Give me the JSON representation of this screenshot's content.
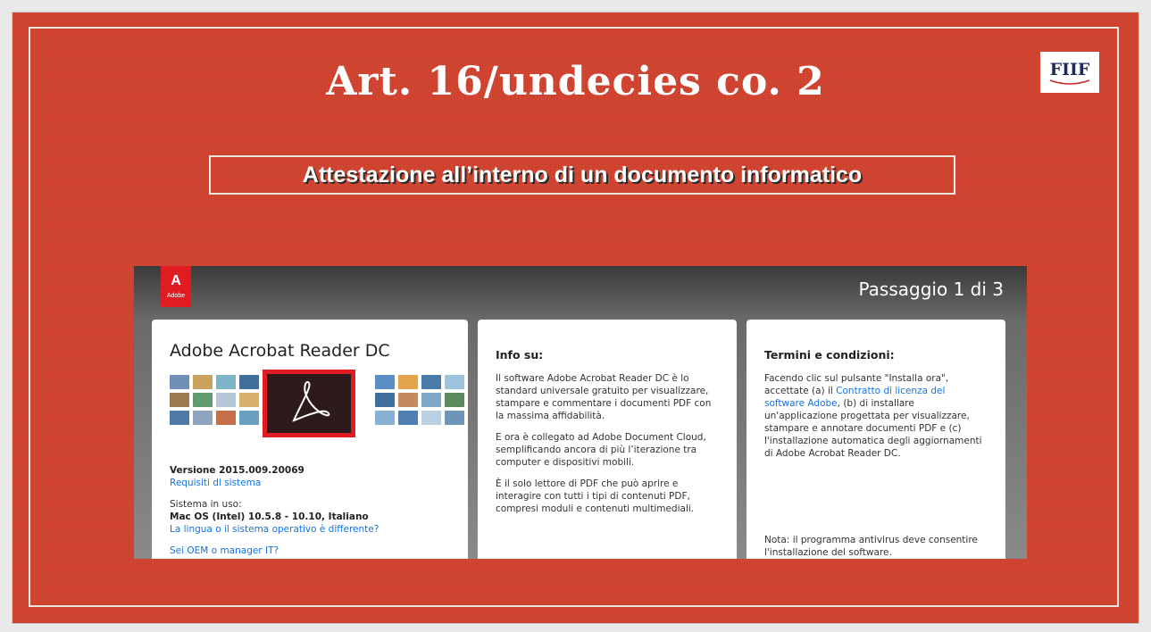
{
  "slide": {
    "title": "Art. 16/undecies co. 2",
    "logo_text": "FIIF",
    "subtitle": "Attestazione all’interno di un documento informatico"
  },
  "installer": {
    "brand_badge": "Adobe",
    "step": "Passaggio 1 di 3",
    "product": {
      "name": "Adobe Acrobat Reader DC",
      "version": "Versione 2015.009.20069",
      "requirements_link": "Requisiti di sistema",
      "system_label": "Sistema in uso:",
      "system_value": "Mac OS (Intel) 10.5.8 - 10.10, Italiano",
      "different_link": "La lingua o il sistema operativo è differente?",
      "oem_link": "Sei OEM o manager IT?"
    },
    "info": {
      "heading": "Info su:",
      "paragraphs": [
        "Il software Adobe Acrobat Reader DC è lo standard universale gratuito per visualizzare, stampare e commentare i documenti PDF con la massima affidabilità.",
        "E ora è collegato ad Adobe Document Cloud, semplificando ancora di più l’iterazione tra computer e dispositivi mobili.",
        "È il solo lettore di PDF che può aprire e interagire con tutti i tipi di contenuti PDF, compresi moduli e contenuti multimediali."
      ]
    },
    "terms": {
      "heading": "Termini e condizioni:",
      "text_before": "Facendo clic sul pulsante \"Installa ora\", accettate (a) il ",
      "license_link": "Contratto di licenza del software Adobe",
      "text_after": ", (b) di installare un'applicazione progettata per visualizzare, stampare e annotare documenti PDF e (c) l'installazione automatica degli aggiornamenti di Adobe Acrobat Reader DC.",
      "note": "Nota: il programma antivirus deve consentire l'installazione del software."
    }
  },
  "colors": {
    "slide_red": "#d2432f",
    "adobe_red": "#e11b22",
    "link_blue": "#1473e6"
  }
}
